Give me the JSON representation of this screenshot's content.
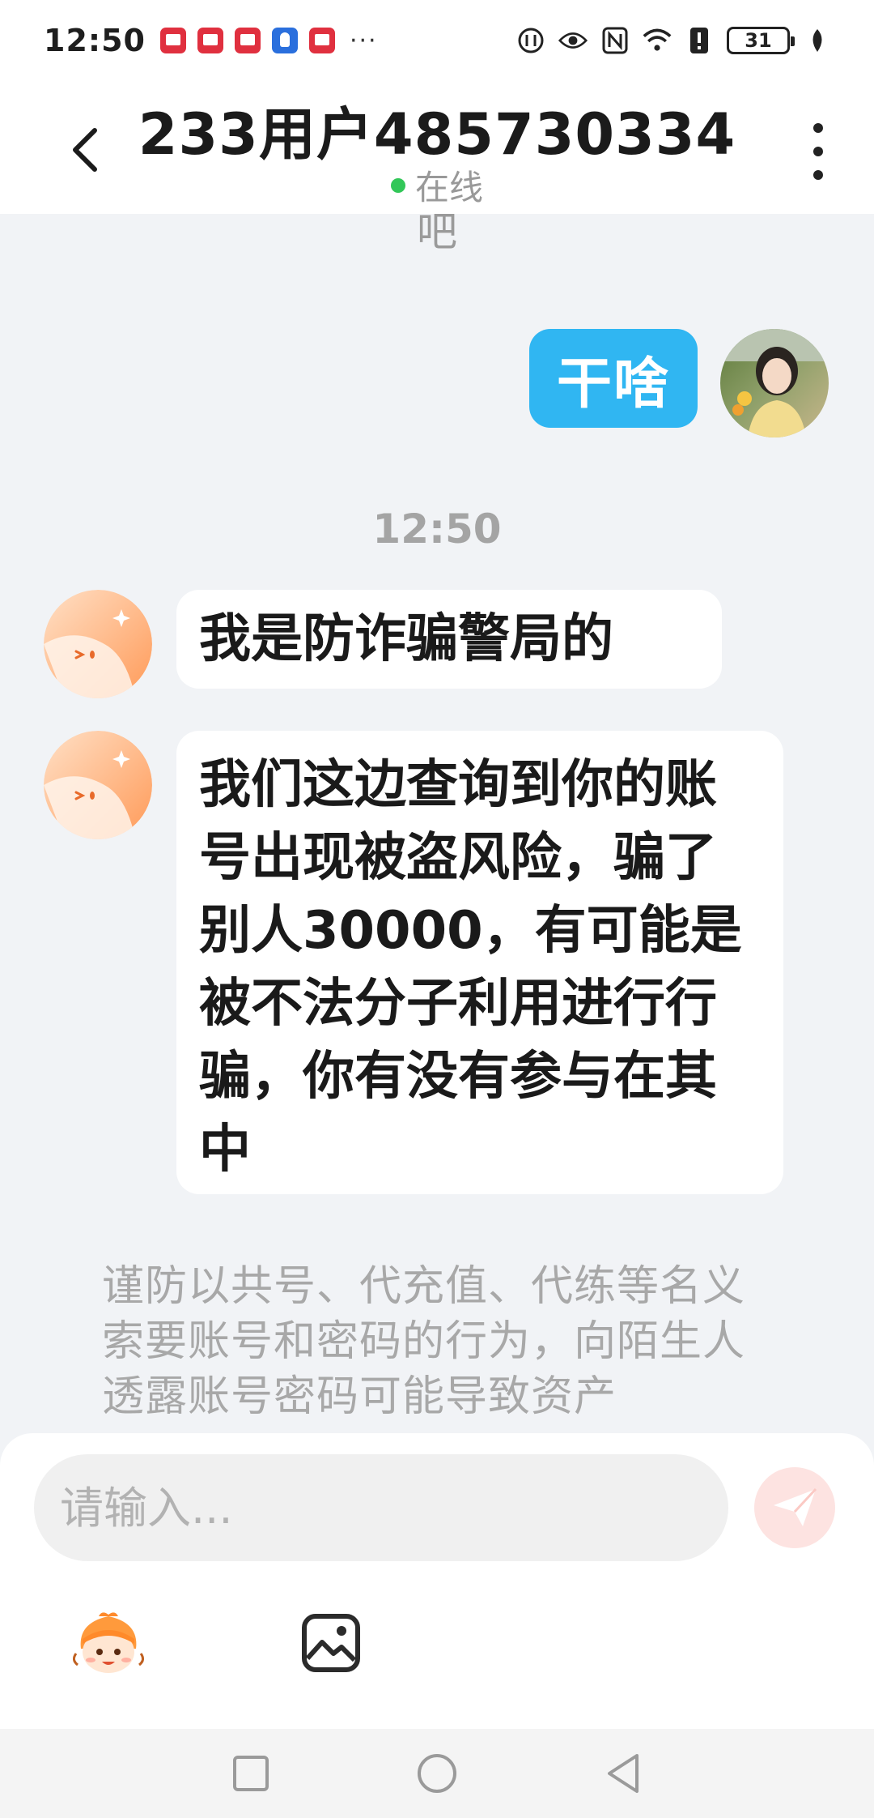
{
  "status_bar": {
    "time": "12:50",
    "more": "···",
    "battery": "31",
    "icons": [
      "red-app-icon",
      "red-app-icon",
      "red-app-icon",
      "blue-bulb-icon",
      "red-app-icon",
      "data-signal-icon",
      "eye-icon",
      "nfc-icon",
      "wifi-icon",
      "alert-icon",
      "battery-icon",
      "leaf-icon"
    ]
  },
  "header": {
    "title": "233用户485730334",
    "status": "在线",
    "status_color": "#32c758"
  },
  "chat": {
    "partial_previous": "吧",
    "self_message": "干啥",
    "time_divider": "12:50",
    "messages": [
      "我是防诈骗警局的",
      "我们这边查询到你的账号出现被盗风险，骗了别人30000，有可能是被不法分子利用进行行骗，你有没有参与在其中"
    ],
    "notice": "谨防以共号、代充值、代练等名义索要账号和密码的行为，向陌生人透露账号密码可能导致资产"
  },
  "input": {
    "placeholder": "请输入..."
  },
  "colors": {
    "self_bubble": "#30b6f2",
    "background": "#f1f3f6",
    "send_button": "#fde3e1"
  }
}
